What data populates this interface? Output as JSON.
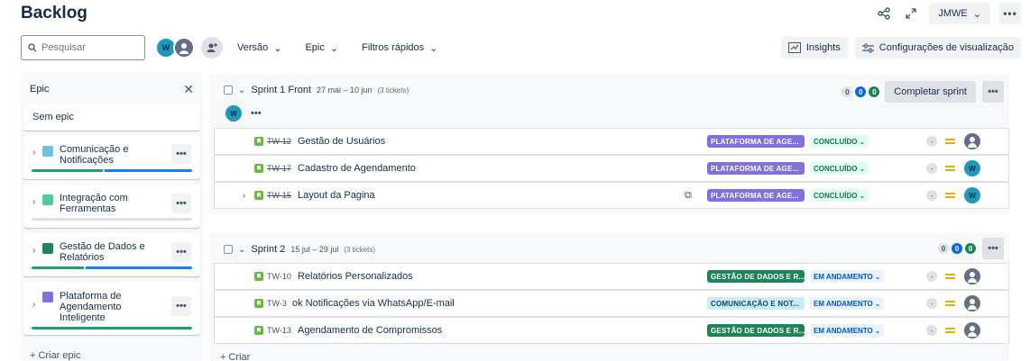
{
  "page": {
    "title": "Backlog"
  },
  "top_right": {
    "project_label": "JMWE"
  },
  "toolbar": {
    "search_placeholder": "Pesquisar",
    "avatar_initial": "W",
    "versao_label": "Versão",
    "epic_label": "Epic",
    "filtros_label": "Filtros rápidos",
    "insights_label": "Insights",
    "config_label": "Configurações de visualização"
  },
  "epic_panel": {
    "title": "Epic",
    "sem_epic": "Sem epic",
    "epics": [
      {
        "name": "Comunicação e Notificações",
        "color": "#6cc3e0",
        "done_pct": 45,
        "progress_pct": 55
      },
      {
        "name": "Integração com Ferramentas",
        "color": "#4bce97",
        "done_pct": 0,
        "progress_pct": 0
      },
      {
        "name": "Gestão de Dados e Relatórios",
        "color": "#1f845a",
        "done_pct": 33,
        "progress_pct": 67
      },
      {
        "name": "Plataforma de Agendamento Inteligente",
        "color": "#8270db",
        "done_pct": 100,
        "progress_pct": 0
      }
    ],
    "create_label": "+ Criar epic"
  },
  "sprints": [
    {
      "name": "Sprint 1 Front",
      "dates": "27 mai – 10 jun",
      "count": "(3 tickets)",
      "counts": {
        "todo": "0",
        "progress": "0",
        "done": "0"
      },
      "action_label": "Completar sprint",
      "assignee_initial": "W",
      "issues": [
        {
          "key": "TW-12",
          "summary": "Gestão de Usuários",
          "epic": "PLATAFORMA DE AGE...",
          "epic_color": "#8270db",
          "status": "CONCLUÍDO",
          "estimate": "-"
        },
        {
          "key": "TW-17",
          "summary": "Cadastro de Agendamento",
          "epic": "PLATAFORMA DE AGE...",
          "epic_color": "#8270db",
          "status": "CONCLUÍDO",
          "estimate": "-",
          "assignee": "W"
        },
        {
          "key": "TW-15",
          "summary": "Layout da Pagina",
          "epic": "PLATAFORMA DE AGE...",
          "epic_color": "#8270db",
          "status": "CONCLUÍDO",
          "estimate": "-",
          "assignee": "W"
        }
      ]
    },
    {
      "name": "Sprint 2",
      "dates": "15 jul – 29 jul",
      "count": "(3 tickets)",
      "counts": {
        "todo": "0",
        "progress": "0",
        "done": "0"
      },
      "issues": [
        {
          "key": "TW-10",
          "summary": "Relatórios Personalizados",
          "epic": "GESTÃO DE DADOS E R...",
          "epic_color": "#1f845a",
          "status": "EM ANDAMENTO",
          "estimate": "-"
        },
        {
          "key": "TW-3",
          "summary": "ok Notificações via WhatsApp/E-mail",
          "epic": "COMUNICAÇÃO E NOT...",
          "epic_color": "#c6edfb",
          "status": "EM ANDAMENTO",
          "estimate": "-"
        },
        {
          "key": "TW-13",
          "summary": "Agendamento de Compromissos",
          "epic": "GESTÃO DE DADOS E R...",
          "epic_color": "#1f845a",
          "status": "EM ANDAMENTO",
          "estimate": "-"
        }
      ]
    }
  ],
  "create_label": "+ Criar"
}
